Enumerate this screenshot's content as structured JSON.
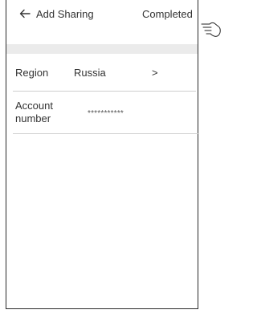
{
  "header": {
    "back_icon": "arrow-left-icon",
    "title": "Add Sharing",
    "completed_label": "Completed"
  },
  "form": {
    "region": {
      "label": "Region",
      "value": "Russia",
      "chevron": ">"
    },
    "account": {
      "label": "Account number",
      "value": "***********"
    }
  },
  "annotation": {
    "pointer_icon": "hand-pointer-icon"
  }
}
